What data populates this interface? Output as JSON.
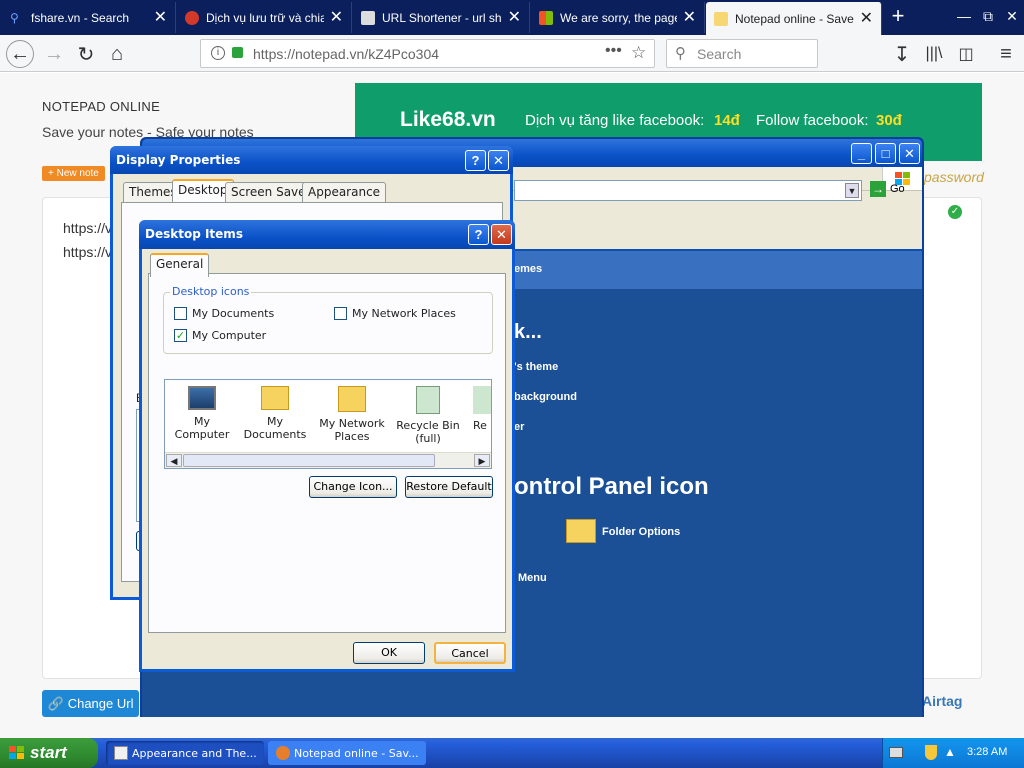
{
  "browser": {
    "tabs": [
      {
        "title": "fshare.vn - Search",
        "color": "#3b6fd1"
      },
      {
        "title": "Dịch vụ lưu trữ và chia s",
        "color": "#d2392b"
      },
      {
        "title": "URL Shortener - url shor",
        "color": "#bbbbbb"
      },
      {
        "title": "We are sorry, the page y",
        "color": "#f35325"
      },
      {
        "title": "Notepad online - Save n",
        "color": "#f7d774"
      }
    ],
    "url": "https://notepad.vn/kZ4Pco304",
    "search_placeholder": "Search"
  },
  "page": {
    "title": "NOTEPAD ONLINE",
    "subtitle": "Save your notes - Safe your notes",
    "new_note": "+ New note",
    "note_lines": [
      "https://v",
      "https://v"
    ],
    "banner": {
      "brand": "Like68.vn",
      "text1": "Dịch vụ tăng like facebook:",
      "price1": "14đ",
      "text2": "Follow facebook:",
      "price2": "30đ"
    },
    "password_text": "password",
    "change_url": "Change Url",
    "airtag": "Airtag"
  },
  "control_panel": {
    "go_label": "Go",
    "band_text": "emes",
    "heading": "k...",
    "link1": "'s theme",
    "link2": "background",
    "link3": "er",
    "cp_icon_heading": "ontrol Panel icon",
    "folder_options": "Folder Options",
    "menu_text": "Menu"
  },
  "display_properties": {
    "title": "Display Properties",
    "tabs": [
      "Themes",
      "Desktop",
      "Screen Saver",
      "Appearance"
    ],
    "side_letter": "B"
  },
  "desktop_items": {
    "title": "Desktop Items",
    "tab": "General",
    "group_label": "Desktop icons",
    "checkboxes": [
      {
        "label": "My Documents",
        "checked": false
      },
      {
        "label": "My Network Places",
        "checked": false
      },
      {
        "label": "My Computer",
        "checked": true
      }
    ],
    "icons": [
      "My Computer",
      "My Documents",
      "My Network Places",
      "Recycle Bin (full)",
      "Re"
    ],
    "change_icon": "Change Icon...",
    "restore_default": "Restore Default",
    "ok": "OK",
    "cancel": "Cancel"
  },
  "taskbar": {
    "start": "start",
    "tasks": [
      "Appearance and The...",
      "Notepad online - Sav..."
    ],
    "clock": "3:28 AM"
  }
}
